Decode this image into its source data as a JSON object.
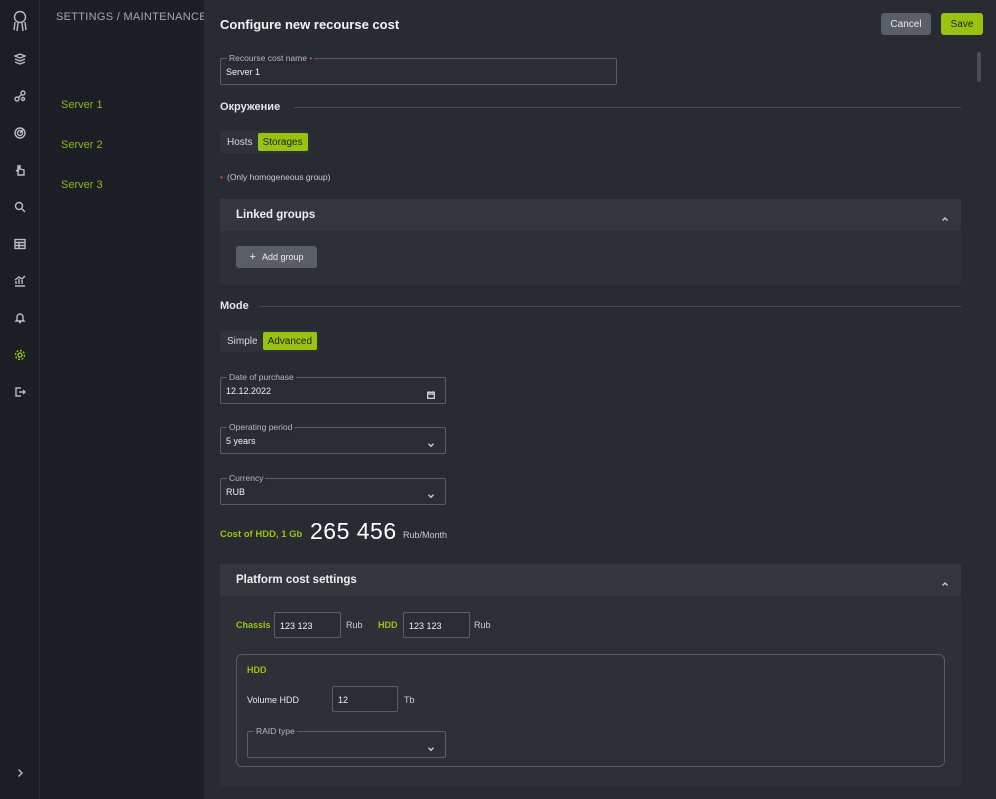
{
  "breadcrumb": "SETTINGS  /  MAINTENANCE  /",
  "sidebar": {
    "servers": [
      "Server 1",
      "Server 2",
      "Server 3"
    ]
  },
  "panel": {
    "title": "Configure new recourse cost",
    "cancel_label": "Cancel",
    "save_label": "Save",
    "name_field": {
      "label": "Recourse cost name",
      "value": "Server 1"
    },
    "environment": {
      "section_title": "Окружение",
      "options": [
        "Hosts",
        "Storages"
      ],
      "selected": "Storages",
      "note": "(Only homogeneous group)"
    },
    "linked_groups": {
      "title": "Linked groups",
      "add_label": "Add group"
    },
    "mode": {
      "section_title": "Mode",
      "options": [
        "Simple",
        "Advanced"
      ],
      "selected": "Advanced"
    },
    "date_of_purchase": {
      "label": "Date of purchase",
      "value": "12.12.2022"
    },
    "operating_period": {
      "label": "Operating period",
      "value": "5 years"
    },
    "currency": {
      "label": "Currency",
      "value": "RUB"
    },
    "cost": {
      "label": "Cost of HDD, 1 Gb",
      "value": "265 456",
      "unit": "Rub/Month"
    },
    "platform": {
      "title": "Platform cost settings",
      "chassis_label": "Chassis",
      "chassis_value": "123 123",
      "chassis_unit": "Rub",
      "hdd_label": "HDD",
      "hdd_value": "123 123",
      "hdd_unit": "Rub",
      "hdd_box": {
        "heading": "HDD",
        "volume_label": "Volume HDD",
        "volume_value": "12",
        "volume_unit": "Tb",
        "raid_label": "RAID type",
        "raid_value": ""
      }
    }
  },
  "colors": {
    "accent": "#9ac311",
    "required": "#e04848"
  },
  "rail_icons": [
    "logo-icon",
    "layers-icon",
    "nodes-icon",
    "radar-icon",
    "pointer-icon",
    "search-icon",
    "table-icon",
    "chart-icon",
    "bell-icon",
    "gear-icon",
    "logout-icon",
    "expand-icon"
  ]
}
